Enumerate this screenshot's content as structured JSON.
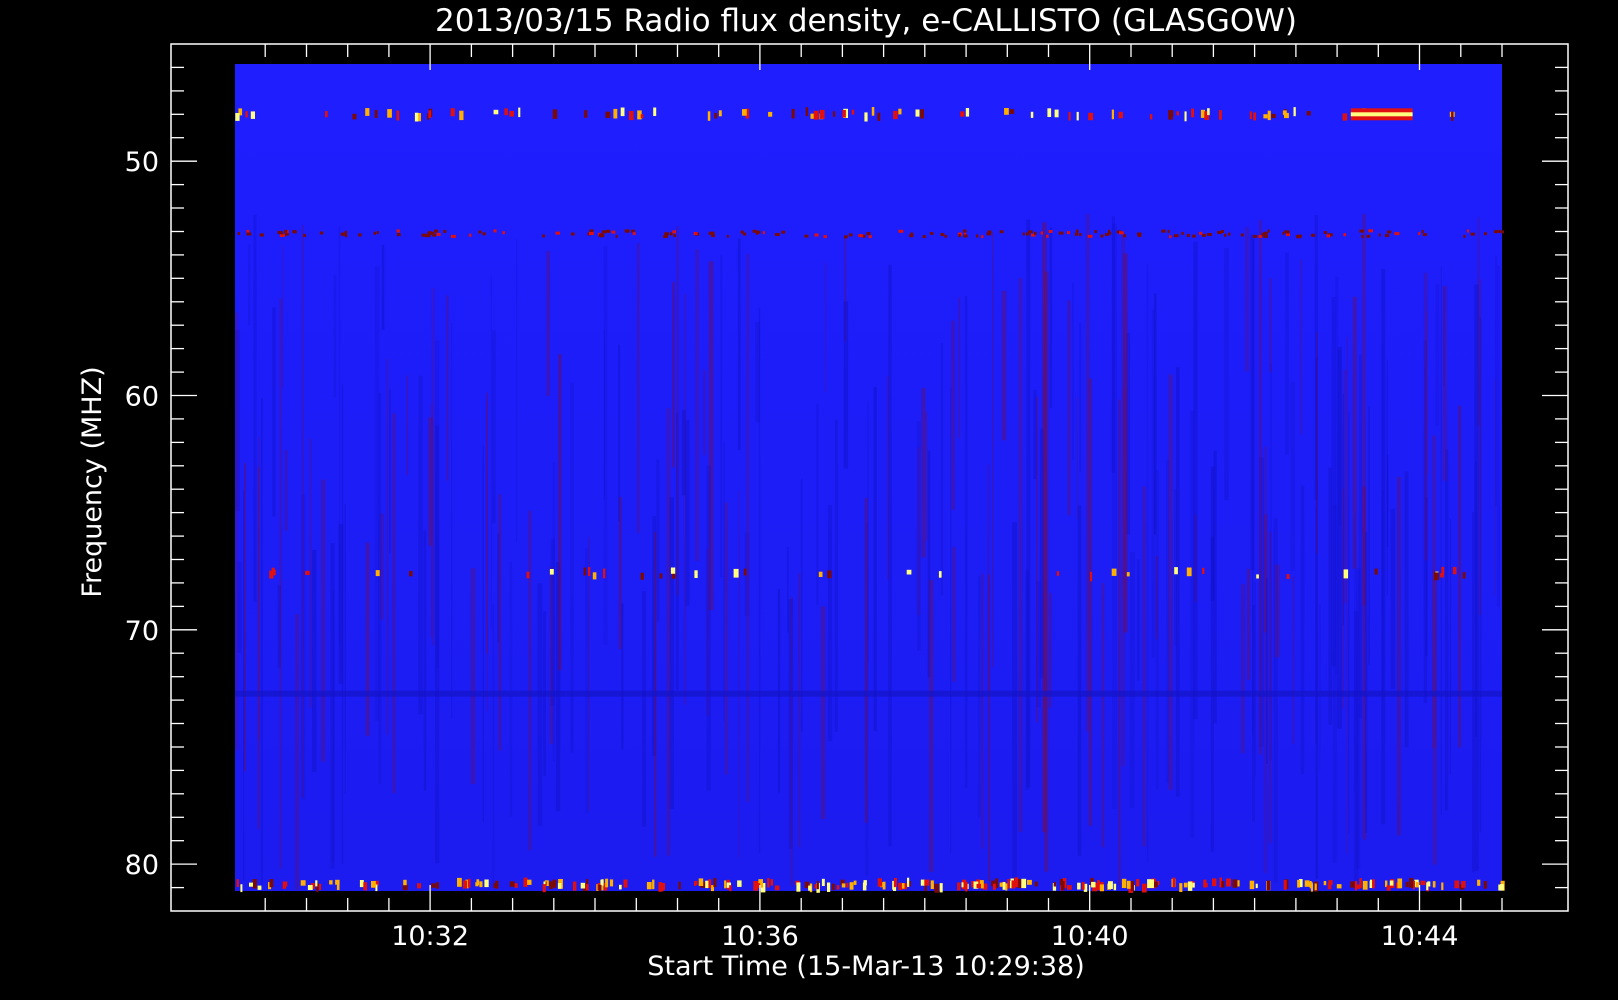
{
  "chart_data": {
    "type": "heatmap",
    "title": "2013/03/15  Radio flux density, e-CALLISTO (GLASGOW)",
    "xlabel": "Start Time (15-Mar-13 10:29:38)",
    "ylabel": "Frequency (MHZ)",
    "x_range": [
      "10:29:38",
      "10:45:00"
    ],
    "y_range_mhz": [
      45,
      82
    ],
    "y_inverted": true,
    "x_ticks": [
      "10:32",
      "10:36",
      "10:40",
      "10:44"
    ],
    "y_ticks": [
      50,
      60,
      70,
      80
    ],
    "colormap": [
      "#1e1eff",
      "#7a0a0a",
      "#e01010",
      "#ffb000",
      "#ffff80"
    ],
    "background_level_color": "#1e1eff",
    "persistent_emission_bands_mhz": [
      48.0,
      53.1,
      67.6,
      80.9
    ],
    "burst_patches": [
      {
        "time_start": "10:43:10",
        "time_end": "10:43:55",
        "freq_mhz": 48.0,
        "level": "max"
      }
    ]
  }
}
